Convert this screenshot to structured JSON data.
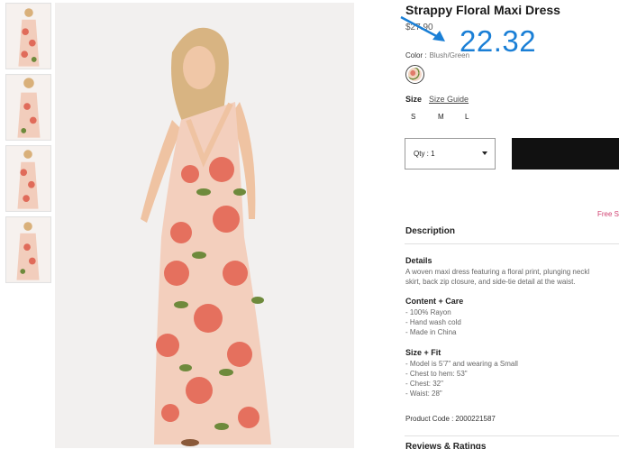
{
  "product": {
    "title": "Strappy Floral Maxi Dress",
    "original_price": "$27.90",
    "annotated_price": "22.32",
    "color_label": "Color :",
    "color_value": "Blush/Green",
    "size_label": "Size",
    "size_guide_link": "Size Guide",
    "sizes": [
      "S",
      "M",
      "L"
    ],
    "qty_label": "Qty : 1",
    "free_shipping": "Free S",
    "description_heading": "Description",
    "details_heading": "Details",
    "details_line1": "A woven maxi dress featuring a floral print, plunging neckl",
    "details_line2": "skirt, back zip closure, and side-tie detail at the waist.",
    "content_heading": "Content + Care",
    "content_lines": [
      "- 100% Rayon",
      "- Hand wash cold",
      "- Made in China"
    ],
    "sizefit_heading": "Size + Fit",
    "sizefit_lines": [
      "- Model is 5'7\" and wearing a Small",
      "- Chest to hem: 53\"",
      "- Chest: 32\"",
      "- Waist: 28\""
    ],
    "product_code_label": "Product Code :",
    "product_code": "2000221587",
    "reviews_heading": "Reviews & Ratings"
  },
  "colors": {
    "annotation_blue": "#1a7fd6",
    "add_to_bag_bg": "#111111",
    "free_ship_pink": "#d04070"
  }
}
